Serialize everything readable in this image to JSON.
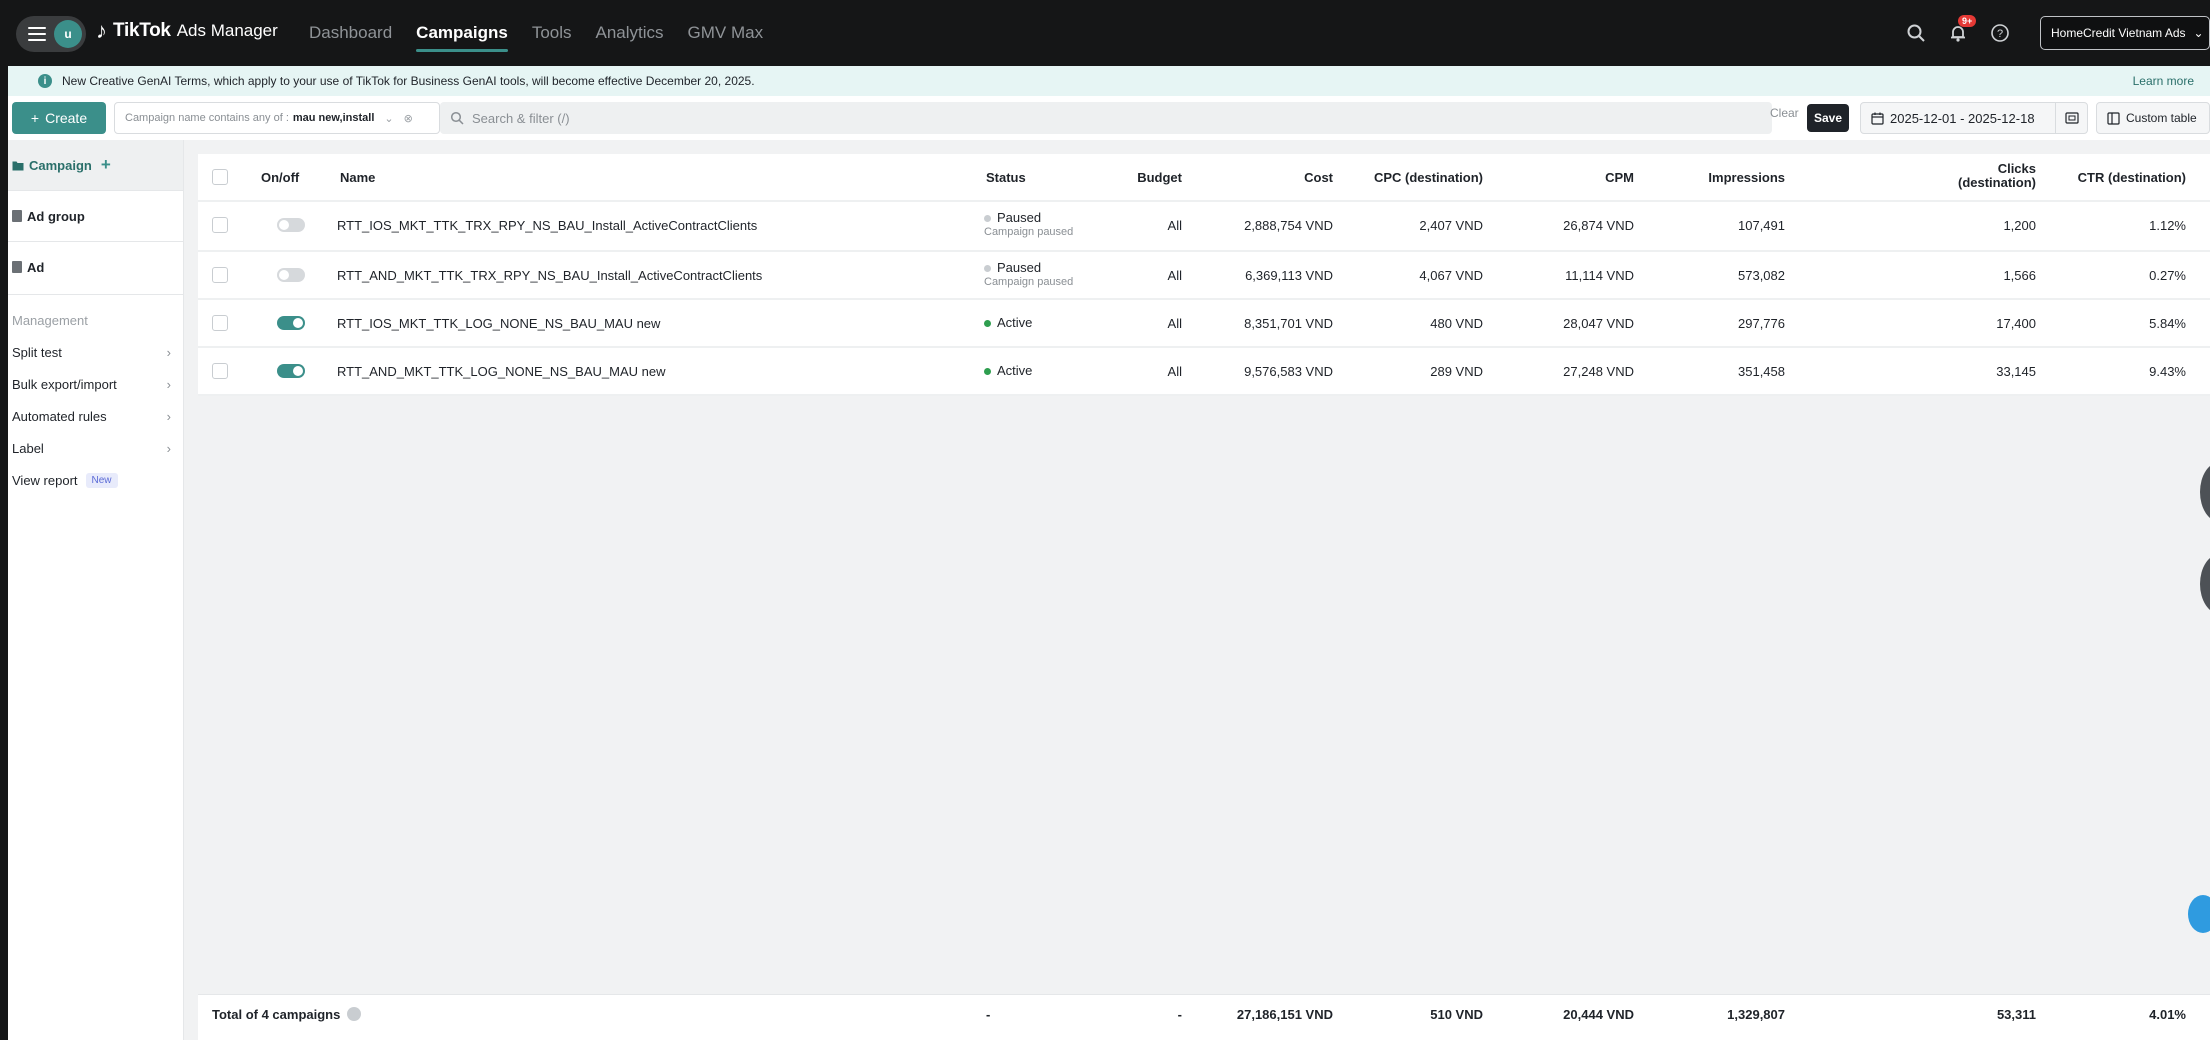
{
  "topbar": {
    "avatar_letter": "u",
    "brand_name": "TikTok",
    "brand_sub": "Ads Manager",
    "nav": [
      {
        "label": "Dashboard",
        "active": false
      },
      {
        "label": "Campaigns",
        "active": true
      },
      {
        "label": "Tools",
        "active": false
      },
      {
        "label": "Analytics",
        "active": false
      },
      {
        "label": "GMV Max",
        "active": false
      }
    ],
    "notification_badge": "9+",
    "account_name": "HomeCredit Vietnam Ads"
  },
  "notice": {
    "text": "New Creative GenAI Terms, which apply to your use of TikTok for Business GenAI tools, will become effective December 20, 2025.",
    "link": "Learn more"
  },
  "toolbar": {
    "create_label": "Create",
    "filter_prefix": "Campaign name contains any of :",
    "filter_value": "mau new,install",
    "search_placeholder": "Search & filter (/)",
    "clear_label": "Clear",
    "save_label": "Save",
    "date_range": "2025-12-01 - 2025-12-18",
    "custom_table_label": "Custom table"
  },
  "sidebar": {
    "levels": [
      {
        "label": "Campaign",
        "active": true
      },
      {
        "label": "Ad group",
        "active": false
      },
      {
        "label": "Ad",
        "active": false
      }
    ],
    "management_title": "Management",
    "management_items": [
      {
        "label": "Split test",
        "chevron": true
      },
      {
        "label": "Bulk export/import",
        "chevron": true
      },
      {
        "label": "Automated rules",
        "chevron": true
      },
      {
        "label": "Label",
        "chevron": true
      },
      {
        "label": "View report",
        "chevron": false,
        "badge": "New"
      }
    ]
  },
  "table": {
    "headers": {
      "onoff": "On/off",
      "name": "Name",
      "status": "Status",
      "budget": "Budget",
      "cost": "Cost",
      "cpc": "CPC (destination)",
      "cpm": "CPM",
      "impressions": "Impressions",
      "clicks_line1": "Clicks",
      "clicks_line2": "(destination)",
      "ctr": "CTR (destination)"
    },
    "rows": [
      {
        "on": false,
        "name": "RTT_IOS_MKT_TTK_TRX_RPY_NS_BAU_Install_ActiveContractClients",
        "status": "Paused",
        "status_sub": "Campaign paused",
        "budget": "All",
        "cost": "2,888,754 VND",
        "cpc": "2,407 VND",
        "cpm": "26,874 VND",
        "impressions": "107,491",
        "clicks": "1,200",
        "ctr": "1.12%"
      },
      {
        "on": false,
        "name": "RTT_AND_MKT_TTK_TRX_RPY_NS_BAU_Install_ActiveContractClients",
        "status": "Paused",
        "status_sub": "Campaign paused",
        "budget": "All",
        "cost": "6,369,113 VND",
        "cpc": "4,067 VND",
        "cpm": "11,114 VND",
        "impressions": "573,082",
        "clicks": "1,566",
        "ctr": "0.27%"
      },
      {
        "on": true,
        "name": "RTT_IOS_MKT_TTK_LOG_NONE_NS_BAU_MAU new",
        "status": "Active",
        "status_sub": "",
        "budget": "All",
        "cost": "8,351,701 VND",
        "cpc": "480 VND",
        "cpm": "28,047 VND",
        "impressions": "297,776",
        "clicks": "17,400",
        "ctr": "5.84%"
      },
      {
        "on": true,
        "name": "RTT_AND_MKT_TTK_LOG_NONE_NS_BAU_MAU new",
        "status": "Active",
        "status_sub": "",
        "budget": "All",
        "cost": "9,576,583 VND",
        "cpc": "289 VND",
        "cpm": "27,248 VND",
        "impressions": "351,458",
        "clicks": "33,145",
        "ctr": "9.43%"
      }
    ],
    "total": {
      "label": "Total of 4 campaigns",
      "status": "-",
      "budget": "-",
      "cost": "27,186,151 VND",
      "cpc": "510 VND",
      "cpm": "20,444 VND",
      "impressions": "1,329,807",
      "clicks": "53,311",
      "ctr": "4.01%"
    }
  },
  "colors": {
    "accent": "#3b8f8a",
    "paused_dot": "#c9cdd1",
    "active_dot": "#2e9e4f",
    "topbar": "#151617"
  }
}
